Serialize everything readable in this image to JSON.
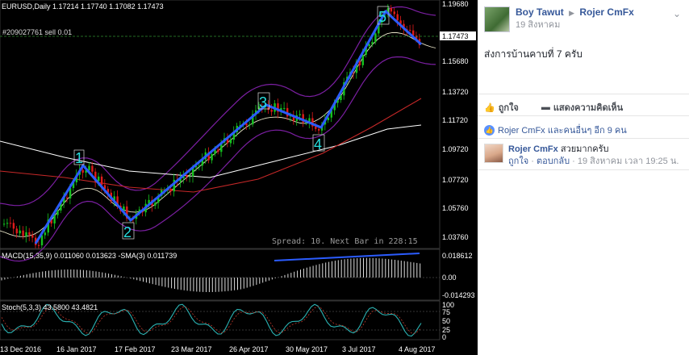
{
  "chart": {
    "symbol_header": "EURUSD,Daily  1.17214 1.17740 1.17082 1.17473",
    "order_label": "#209027761 sell 0.01",
    "current_price": "1.17473",
    "price_axis": [
      "1.19680",
      "1.17473",
      "1.15680",
      "1.13720",
      "1.11720",
      "1.09720",
      "1.07720",
      "1.05760",
      "1.03760"
    ],
    "wave_labels": [
      "1",
      "2",
      "3",
      "4",
      "5"
    ],
    "spread_text": "Spread: 10. Next Bar in 228:15",
    "macd_label": "MACD(15,35,9) 0.011060 0.013623 -SMA(3) 0.011739",
    "macd_axis": [
      "0.018612",
      "0.00",
      "-0.014293"
    ],
    "stoch_label": "Stoch(5,3,3) 43.5800 43.4821",
    "stoch_axis": [
      "100",
      "75",
      "50",
      "25",
      "0"
    ],
    "date_axis": [
      "13 Dec 2016",
      "16 Jan 2017",
      "17 Feb 2017",
      "23 Mar 2017",
      "26 Apr 2017",
      "30 May 2017",
      "3 Jul 2017",
      "4 Aug 2017"
    ],
    "colors": {
      "background": "#000000",
      "bull_candle": "#16c21f",
      "bear_candle": "#e01b1b",
      "wave_line": "#2b5cff",
      "bands": "#7b1fa2",
      "label_text": "#27e0e0"
    }
  },
  "post": {
    "author": "Boy Tawut",
    "target": "Rojer CmFx",
    "date": "19 สิงหาคม",
    "menu_icon": "chevron-down-icon",
    "body": "ส่งการบ้านคาบที่ 7 ครับ",
    "actions": {
      "like": "ถูกใจ",
      "comment": "แสดงความคิดเห็น"
    },
    "likes_summary": "Rojer CmFx และคนอื่นๆ อีก 9 คน",
    "comment": {
      "author": "Rojer CmFx",
      "text": "สวยมากครับ",
      "like": "ถูกใจ",
      "reply": "ตอบกลับ",
      "time": "19 สิงหาคม เวลา 19:25 น."
    }
  }
}
